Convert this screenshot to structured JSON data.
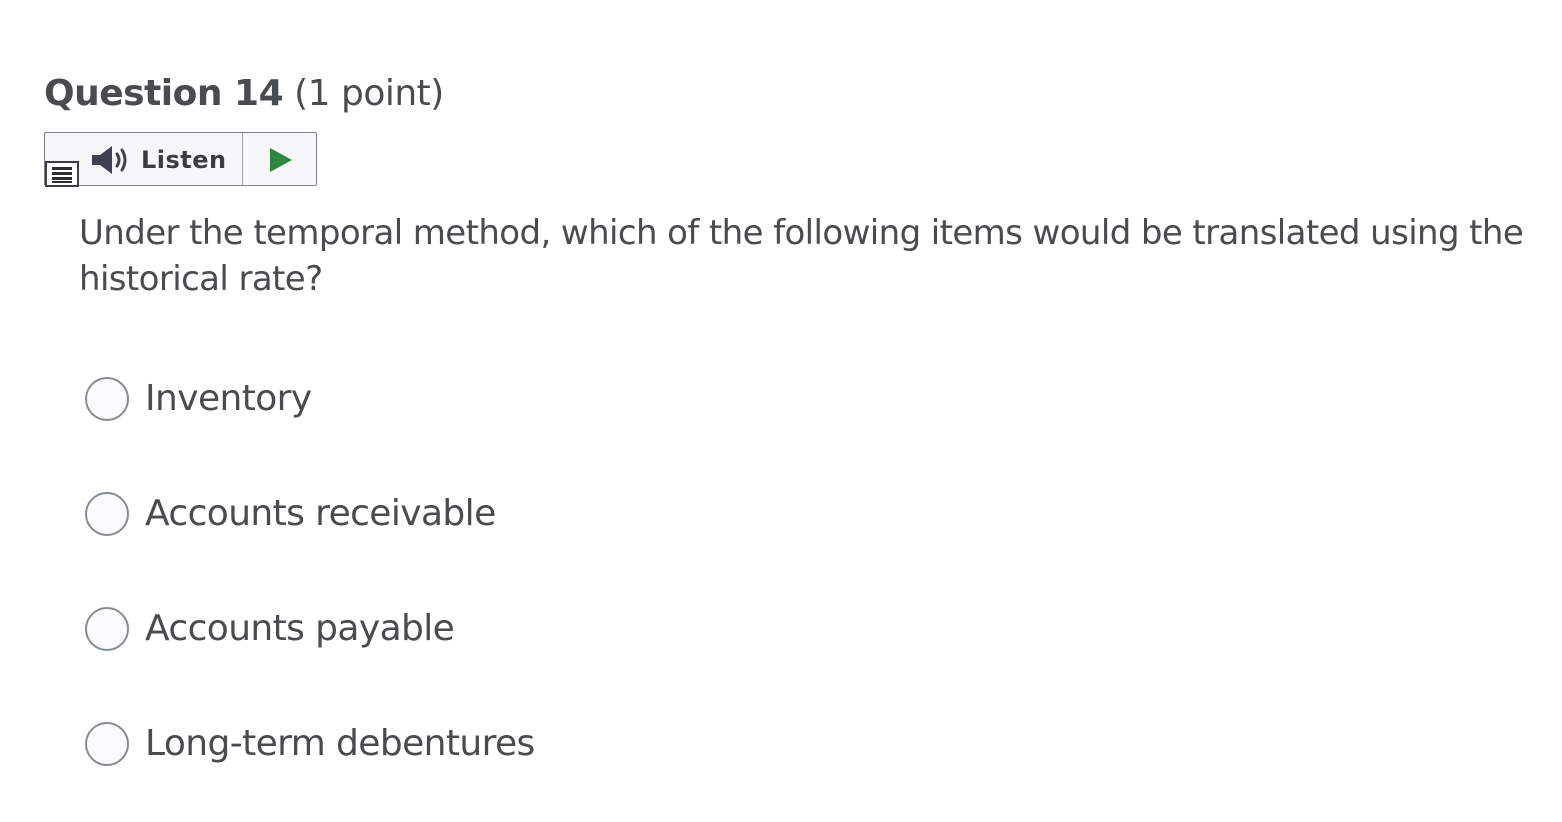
{
  "question": {
    "number_label": "Question 14",
    "points_label": "(1 point)",
    "text": "Under the temporal method, which of the following items would be translated using the historical rate?"
  },
  "toolbar": {
    "listen_label": "Listen",
    "icons": {
      "menu": "menu-icon",
      "speaker": "speaker-icon",
      "play": "play-icon"
    },
    "play_color": "#2e8540"
  },
  "answers": [
    {
      "label": "Inventory",
      "selected": false
    },
    {
      "label": "Accounts receivable",
      "selected": false
    },
    {
      "label": "Accounts payable",
      "selected": false
    },
    {
      "label": "Long-term debentures",
      "selected": false
    }
  ]
}
